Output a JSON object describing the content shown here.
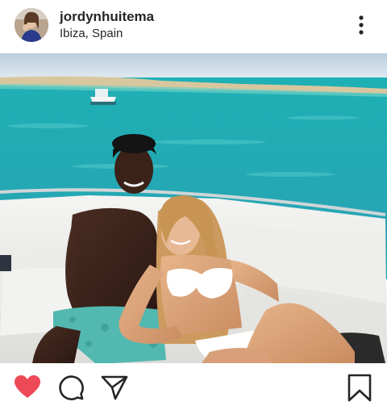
{
  "post": {
    "username": "jordynhuitema",
    "location": "Ibiza, Spain"
  },
  "icons": {
    "avatar": "profile-photo",
    "more": "vertical-ellipsis",
    "like": "heart-filled",
    "comment": "speech-bubble",
    "share": "paper-plane",
    "save": "bookmark"
  },
  "colors": {
    "like_red": "#ed4956",
    "text": "#262626",
    "sea": "#2bb3b8"
  }
}
